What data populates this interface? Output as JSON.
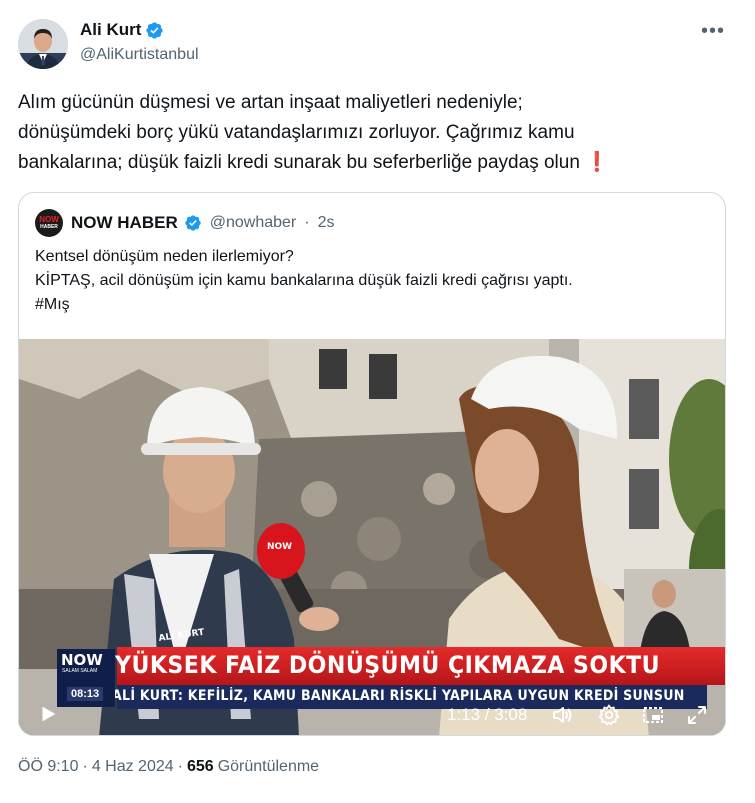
{
  "author": {
    "name": "Ali Kurt",
    "handle": "@AliKurtistanbul",
    "verified_color": "#1d9bf0"
  },
  "more_icon": "more-horizontal-icon",
  "tweet": {
    "line1": "Alım gücünün düşmesi ve artan inşaat maliyetleri nedeniyle;",
    "line2": "dönüşümdeki borç yükü vatandaşlarımızı zorluyor. Çağrımız kamu",
    "line3": "bankalarına; düşük faizli kredi sunarak bu seferberliğe paydaş olun",
    "emoji": "❗"
  },
  "quote": {
    "avatar_line1": "NOW",
    "avatar_line2": "HABER",
    "name": "NOW HABER",
    "handle": "@nowhaber",
    "separator": "·",
    "time": "2s",
    "line1": "Kentsel dönüşüm neden ilerlemiyor?",
    "line2": "KİPTAŞ, acil dönüşüm için kamu bankalarına düşük faizli kredi çağrısı yaptı.",
    "line3": "#Mış"
  },
  "video": {
    "mic_label": "NOW",
    "vest_label": "ALİ KURT",
    "chyron_title": "YÜKSEK FAİZ DÖNÜŞÜMÜ ÇIKMAZA SOKTU",
    "chyron_subtitle": "ALİ KURT: KEFİLİZ, KAMU BANKALARI RİSKLİ YAPILARA UYGUN KREDİ SUNSUN",
    "logo_text": "NOW",
    "logo_sub": "SALAM SALAM",
    "logo_time": "08:13",
    "time_display": "1:13 / 3:08",
    "icons": [
      "play-icon",
      "volume-icon",
      "settings-icon",
      "pip-icon",
      "fullscreen-icon"
    ]
  },
  "meta": {
    "time": "ÖÖ 9:10",
    "sep1": "·",
    "date": "4 Haz 2024",
    "sep2": "·",
    "views": "656",
    "views_label": "Görüntülenme"
  },
  "colors": {
    "accent": "#1d9bf0",
    "text": "#0f1419",
    "muted": "#536471",
    "border": "#cfd9de",
    "chyron_red": "#d71f26",
    "chyron_navy": "#1b2a5c"
  }
}
